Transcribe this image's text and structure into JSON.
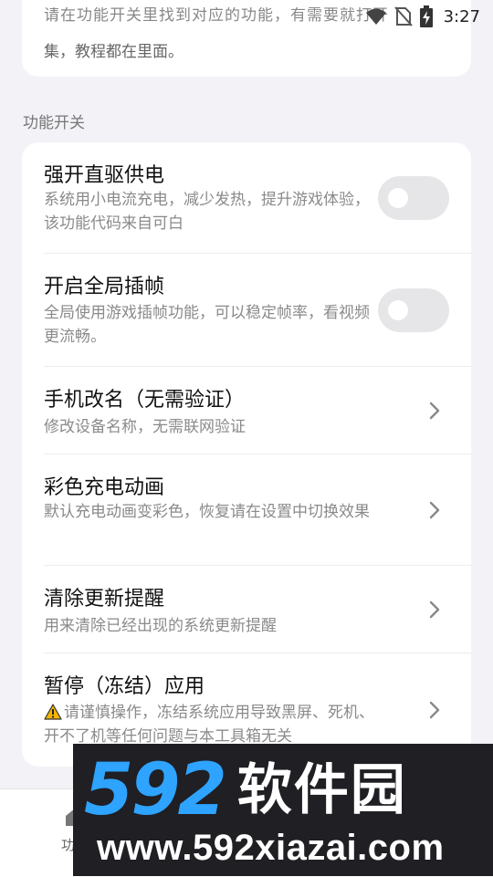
{
  "status_bar": {
    "time": "3:27",
    "icons": [
      "wifi-icon",
      "no-sim-icon",
      "battery-charging-icon"
    ]
  },
  "top_card": {
    "partial_text": "请在功能开关里找到对应的功能，有需要就打开",
    "text": "集，教程都在里面。"
  },
  "section": {
    "title": "功能开关"
  },
  "items": [
    {
      "title": "强开直驱供电",
      "desc": "系统用小电流充电，减少发热，提升游戏体验，该功能代码来自可白",
      "control": "toggle",
      "on": false
    },
    {
      "title": "开启全局插帧",
      "desc": "全局使用游戏插帧功能，可以稳定帧率，看视频更流畅。",
      "control": "toggle",
      "on": false
    },
    {
      "title": "手机改名（无需验证）",
      "desc": "修改设备名称，无需联网验证",
      "control": "chevron"
    },
    {
      "title": "彩色充电动画",
      "desc": "默认充电动画变彩色，恢复请在设置中切换效果",
      "control": "chevron"
    },
    {
      "title": "清除更新提醒",
      "desc": "用来清除已经出现的系统更新提醒",
      "control": "chevron"
    },
    {
      "title": "暂停（冻结）应用",
      "desc": "请谨慎操作，冻结系统应用导致黑屏、死机、开不了机等任何问题与本工具箱无关",
      "desc_icon": "warning-icon",
      "control": "chevron"
    }
  ],
  "bottom_nav": {
    "item_label": "功能"
  },
  "watermark": {
    "number": "592",
    "brand": "软件园",
    "url": "www.592xiazai.com"
  },
  "colors": {
    "background": "#f2f2f7",
    "card": "#ffffff",
    "toggle_off": "#e6e6e8",
    "secondary_text": "#8a8a8a",
    "watermark_blue": "#2ea3ff"
  }
}
